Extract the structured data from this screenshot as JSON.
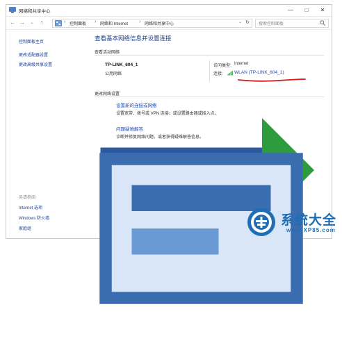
{
  "window": {
    "title": "网络和共享中心",
    "minimize": "—",
    "maximize": "□",
    "close": "✕",
    "chevron": "⌄"
  },
  "nav": {
    "back": "←",
    "forward": "→",
    "up": "↑"
  },
  "address": {
    "crumbs": [
      "控制面板",
      "网络和 Internet",
      "网络和共享中心"
    ],
    "sep": "›"
  },
  "search": {
    "placeholder": "搜索控制面板"
  },
  "sidebar": {
    "items": [
      "控制面板主页",
      "更改适配器设置",
      "更改高级共享设置"
    ],
    "see_also_heading": "另请参阅",
    "see_also": [
      "Internet 选项",
      "Windows 防火墙",
      "家庭组"
    ]
  },
  "main": {
    "heading": "查看基本网络信息并设置连接",
    "active_section": "查看活动网络",
    "network_name": "TP-LINK_604_1",
    "network_type": "公用网络",
    "access_type_label": "访问类型:",
    "access_type_value": "Internet",
    "connections_label": "连接:",
    "connection_value": "WLAN (TP-LINK_604_1)",
    "change_section": "更改网络设置",
    "tasks": [
      {
        "link": "设置新的连接或网络",
        "desc": "设置宽带、拨号或 VPN 连接；或设置路由器或接入点。"
      },
      {
        "link": "问题疑难解答",
        "desc": "诊断并修复网络问题，或者获得疑难解答信息。"
      }
    ]
  },
  "watermark": {
    "text": "系统大全",
    "url": "www.XP85.com"
  },
  "colors": {
    "link": "#1a4bb8",
    "heading": "#1e3f8c",
    "annotation": "#d01818",
    "watermark": "#1e6db5"
  }
}
